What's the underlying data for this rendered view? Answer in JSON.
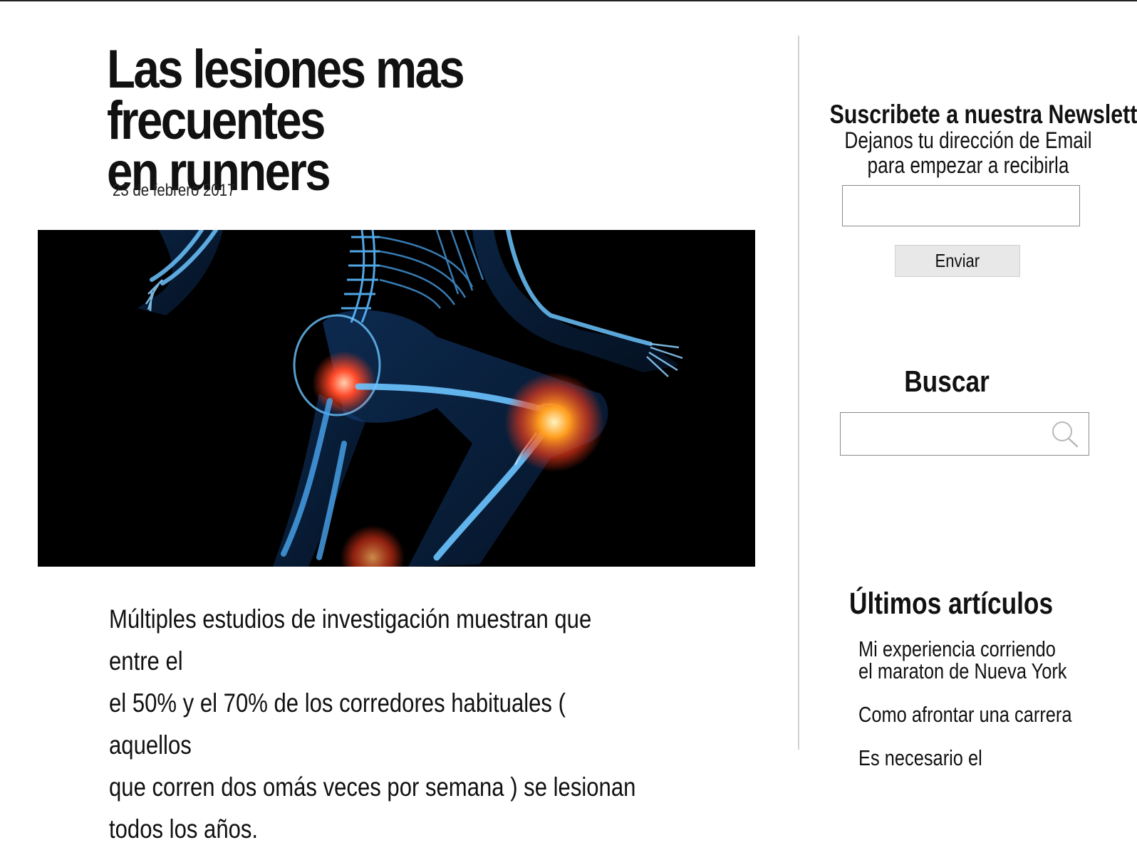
{
  "article": {
    "title_lines": [
      "Las lesiones mas frecuentes",
      "en runners"
    ],
    "date": "23 de febrero 2017",
    "hero_image_alt": "runner-skeleton-knee-injury",
    "body_lines": [
      "Múltiples estudios de investigación muestran que entre el",
      "el 50% y el 70% de los corredores habituales ( aquellos",
      "que corren dos omás veces por semana ) se lesionan",
      "todos los años."
    ]
  },
  "sidebar": {
    "newsletter": {
      "title": "Suscribete a nuestra Newsletter",
      "desc_line1": "Dejanos tu  dirección de Email",
      "desc_line2": "para empezar a recibirla",
      "email_value": "",
      "send_label": "Enviar"
    },
    "search": {
      "title": "Buscar",
      "value": "",
      "icon": "search-icon"
    },
    "latest": {
      "title": "Últimos artículos",
      "items": [
        {
          "line1": "Mi experiencia corriendo",
          "line2": "el maraton de Nueva York"
        },
        {
          "line1": "Como afrontar una carrera",
          "line2": ""
        },
        {
          "line1": "Es necesario el",
          "line2": ""
        }
      ]
    }
  },
  "colors": {
    "hero_bg": "#000000",
    "bone_blue": "#3aa8ff",
    "injury_red": "#ff3a1a",
    "injury_orange": "#ffa020",
    "button_bg": "#e8e8e8",
    "divider": "#d2d2d2"
  }
}
